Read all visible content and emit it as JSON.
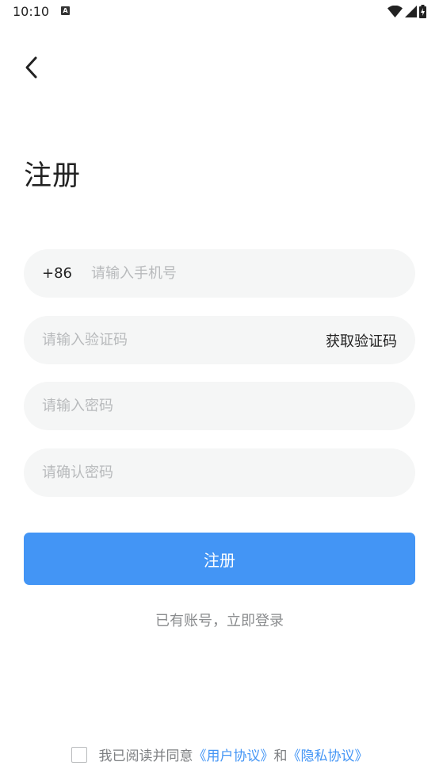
{
  "status_bar": {
    "time": "10:10",
    "notification_icon": "A",
    "icons": [
      "wifi-icon",
      "cellular-signal-icon",
      "battery-charging-icon"
    ]
  },
  "header": {
    "back_icon": "chevron-left-icon"
  },
  "title": "注册",
  "form": {
    "phone": {
      "prefix": "+86",
      "placeholder": "请输入手机号",
      "value": ""
    },
    "code": {
      "placeholder": "请输入验证码",
      "value": "",
      "action_label": "获取验证码"
    },
    "password": {
      "placeholder": "请输入密码",
      "value": ""
    },
    "confirm_password": {
      "placeholder": "请确认密码",
      "value": ""
    },
    "submit_label": "注册"
  },
  "login_link": "已有账号，立即登录",
  "agreement": {
    "checked": false,
    "prefix": "我已阅读并同意",
    "user_agreement": "《用户协议》",
    "conjunction": "和",
    "privacy_policy": "《隐私协议》"
  },
  "colors": {
    "accent": "#4395f5",
    "field_bg": "#f5f6f6",
    "placeholder": "#b8babc"
  }
}
